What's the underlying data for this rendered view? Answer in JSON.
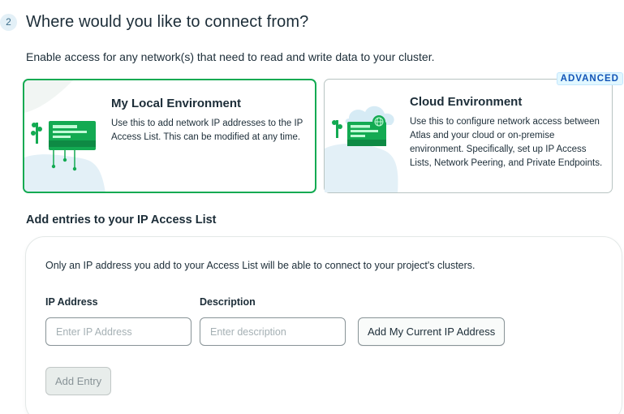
{
  "step": {
    "number": "2",
    "title": "Where would you like to connect from?",
    "subtitle": "Enable access for any network(s) that need to read and write data to your cluster."
  },
  "environments": [
    {
      "title": "My Local Environment",
      "description": "Use this to add network IP addresses to the IP Access List. This can be modified at any time.",
      "selected": true,
      "icon": "local-network-illustration"
    },
    {
      "title": "Cloud Environment",
      "description": "Use this to configure network access between Atlas and your cloud or on-premise environment. Specifically, set up IP Access Lists, Network Peering, and Private Endpoints.",
      "badge": "ADVANCED",
      "selected": false,
      "icon": "cloud-network-illustration"
    }
  ],
  "access_list": {
    "title": "Add entries to your IP Access List",
    "info": "Only an IP address you add to your Access List will be able to connect to your project's clusters.",
    "ip_label": "IP Address",
    "ip_placeholder": "Enter IP Address",
    "ip_value": "",
    "desc_label": "Description",
    "desc_placeholder": "Enter description",
    "desc_value": "",
    "add_current_ip_label": "Add My Current IP Address",
    "add_entry_label": "Add Entry"
  },
  "colors": {
    "accent_green": "#13aa52",
    "advanced_badge_text": "#1254b7"
  }
}
